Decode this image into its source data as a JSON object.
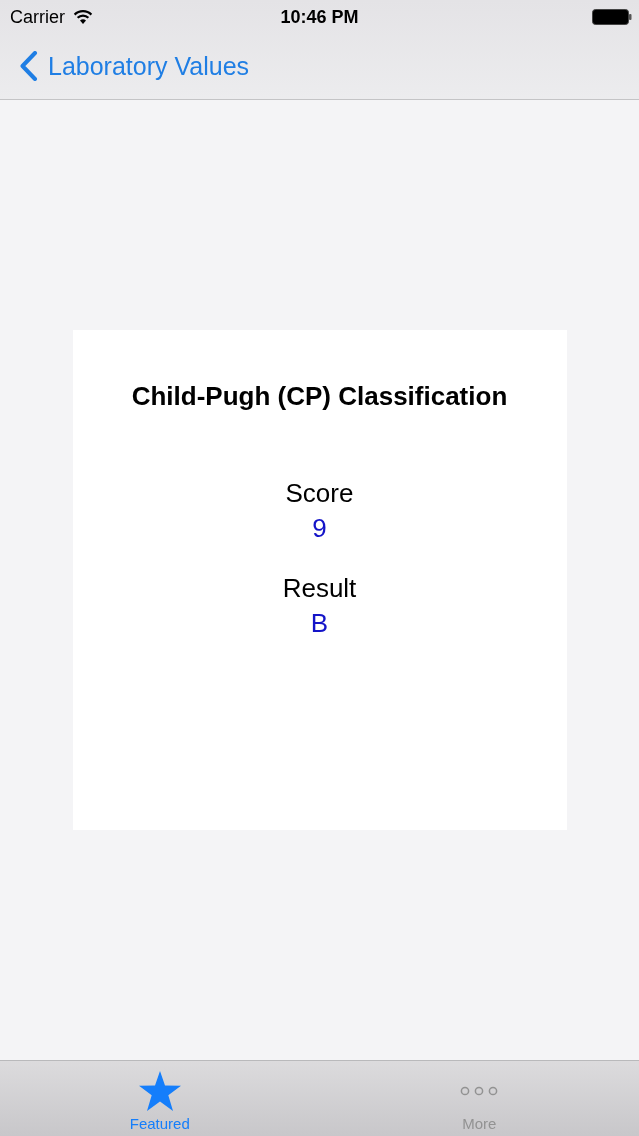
{
  "status_bar": {
    "carrier": "Carrier",
    "time": "10:46 PM"
  },
  "nav_bar": {
    "back_label": "Laboratory Values"
  },
  "card": {
    "title": "Child-Pugh (CP) Classification",
    "fields": [
      {
        "label": "Score",
        "value": "9"
      },
      {
        "label": "Result",
        "value": "B"
      }
    ]
  },
  "tab_bar": {
    "tabs": [
      {
        "label": "Featured",
        "kind": "star",
        "selected": true
      },
      {
        "label": "More",
        "kind": "more",
        "selected": false
      }
    ]
  }
}
